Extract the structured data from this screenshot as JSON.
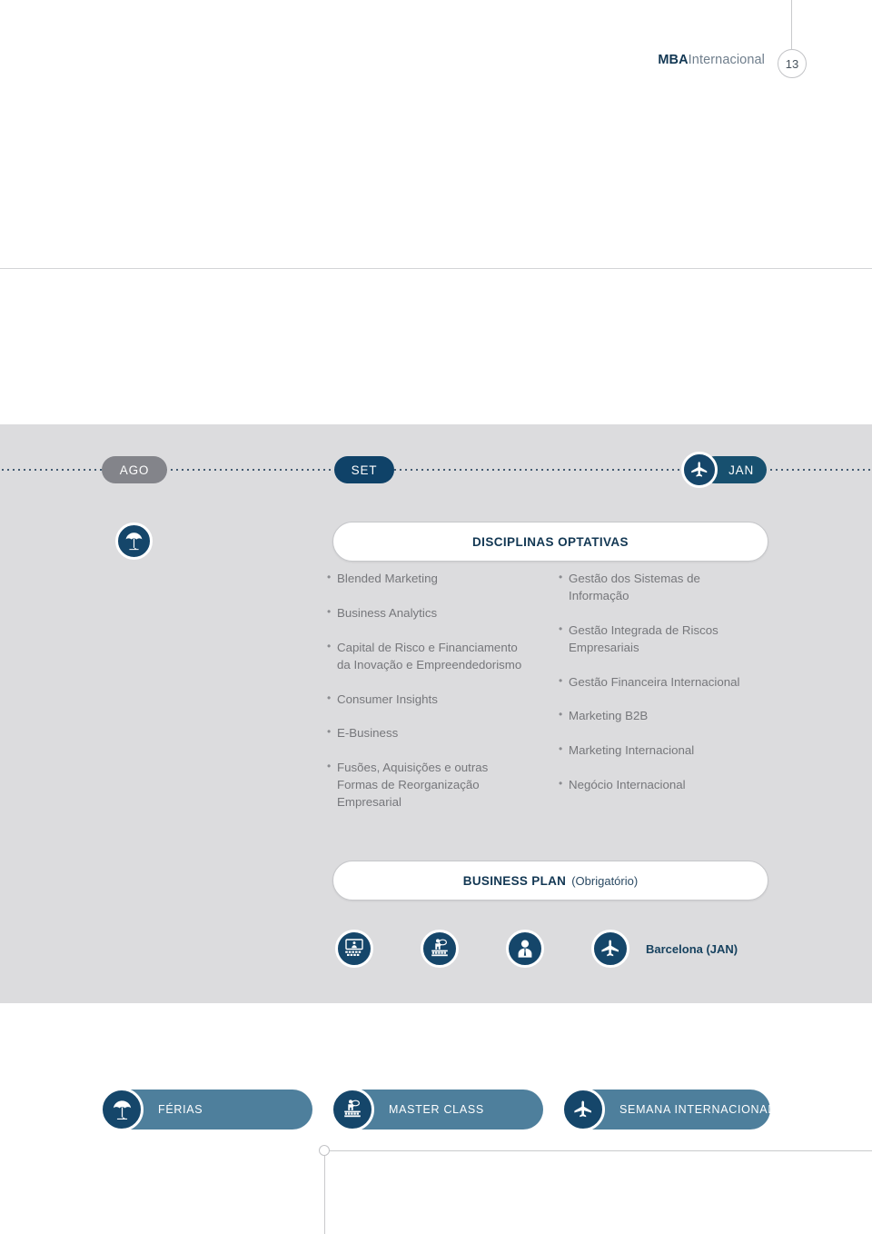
{
  "header": {
    "brand_strong": "MBA",
    "brand_light": "Internacional",
    "page_number": "13"
  },
  "timeline": {
    "months": [
      {
        "label": "AGO",
        "state": "inactive",
        "color": "#83848a"
      },
      {
        "label": "SET",
        "state": "active",
        "color": "#0f4268"
      },
      {
        "label": "JAN",
        "state": "active",
        "color": "#17506f",
        "icon": "airplane-icon"
      }
    ]
  },
  "optativas": {
    "badge_icon": "umbrella-icon",
    "title": "DISCIPLINAS OPTATIVAS",
    "left_column": [
      {
        "lines": [
          "Blended Marketing"
        ]
      },
      {
        "lines": [
          "Business Analytics"
        ]
      },
      {
        "lines": [
          "Capital de Risco e Financiamento",
          "da Inovação e Empreendedorismo"
        ]
      },
      {
        "lines": [
          "Consumer Insights"
        ]
      },
      {
        "lines": [
          "E-Business"
        ]
      },
      {
        "lines": [
          "Fusões, Aquisições e outras",
          "Formas de Reorganização",
          "Empresarial"
        ]
      }
    ],
    "right_column": [
      {
        "lines": [
          "Gestão dos Sistemas de",
          "Informação"
        ]
      },
      {
        "lines": [
          "Gestão Integrada de Riscos",
          "Empresariais"
        ]
      },
      {
        "lines": [
          "Gestão Financeira Internacional"
        ]
      },
      {
        "lines": [
          "Marketing B2B"
        ]
      },
      {
        "lines": [
          "Marketing Internacional"
        ]
      },
      {
        "lines": [
          "Negócio Internacional"
        ]
      }
    ]
  },
  "business_plan": {
    "strong": "BUSINESS PLAN",
    "light": "(Obrigatório)"
  },
  "icon_strip": {
    "icons": [
      "classroom-presentation-icon",
      "master-class-icon",
      "tutor-person-icon",
      "airplane-icon"
    ],
    "destination_label": "Barcelona (JAN)"
  },
  "legend": {
    "items": [
      {
        "icon": "umbrella-icon",
        "label": "FÉRIAS"
      },
      {
        "icon": "master-class-icon",
        "label": "MASTER CLASS"
      },
      {
        "icon": "airplane-icon",
        "label": "SEMANA INTERNACIONAL"
      }
    ]
  },
  "colors": {
    "navy": "#15466a",
    "dark_navy": "#123753",
    "steel_blue": "#4e7f9c",
    "band_gray": "#dcdcde",
    "inactive_gray": "#83848a",
    "body_text_gray": "#76777b"
  }
}
